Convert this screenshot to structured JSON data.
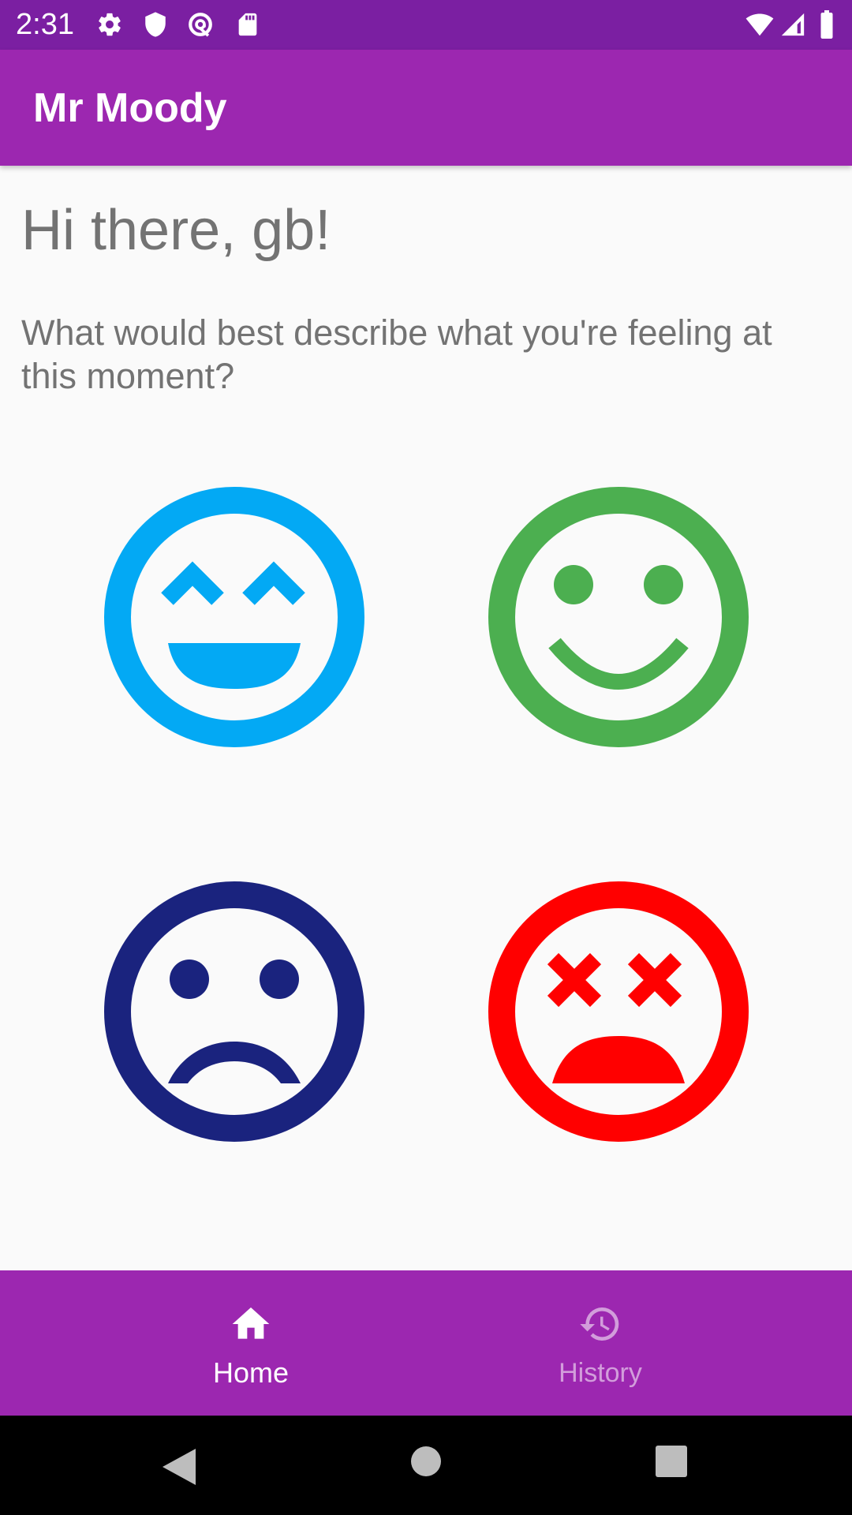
{
  "status_bar": {
    "time": "2:31",
    "left_icons": [
      "gear-icon",
      "shield-icon",
      "at-sign-icon",
      "sd-card-icon"
    ],
    "right_icons": [
      "wifi-icon",
      "cell-signal-icon",
      "battery-icon"
    ],
    "color": "#7b1fa2"
  },
  "app_bar": {
    "title": "Mr Moody",
    "color": "#9c27b0"
  },
  "main": {
    "greeting": "Hi there, gb!",
    "question": "What would best describe what you're feeling at this moment?",
    "moods": [
      {
        "icon": "laughing-face-icon",
        "color": "#03a9f4"
      },
      {
        "icon": "smiling-face-icon",
        "color": "#4caf50"
      },
      {
        "icon": "sad-face-icon",
        "color": "#1a237e"
      },
      {
        "icon": "dizzy-face-icon",
        "color": "#ff0000"
      }
    ]
  },
  "bottom_nav": {
    "items": [
      {
        "label": "Home",
        "icon": "home-icon",
        "active": true
      },
      {
        "label": "History",
        "icon": "history-icon",
        "active": false
      }
    ]
  },
  "system_nav": {
    "buttons": [
      "back-icon",
      "home-circle-icon",
      "recents-icon"
    ]
  }
}
